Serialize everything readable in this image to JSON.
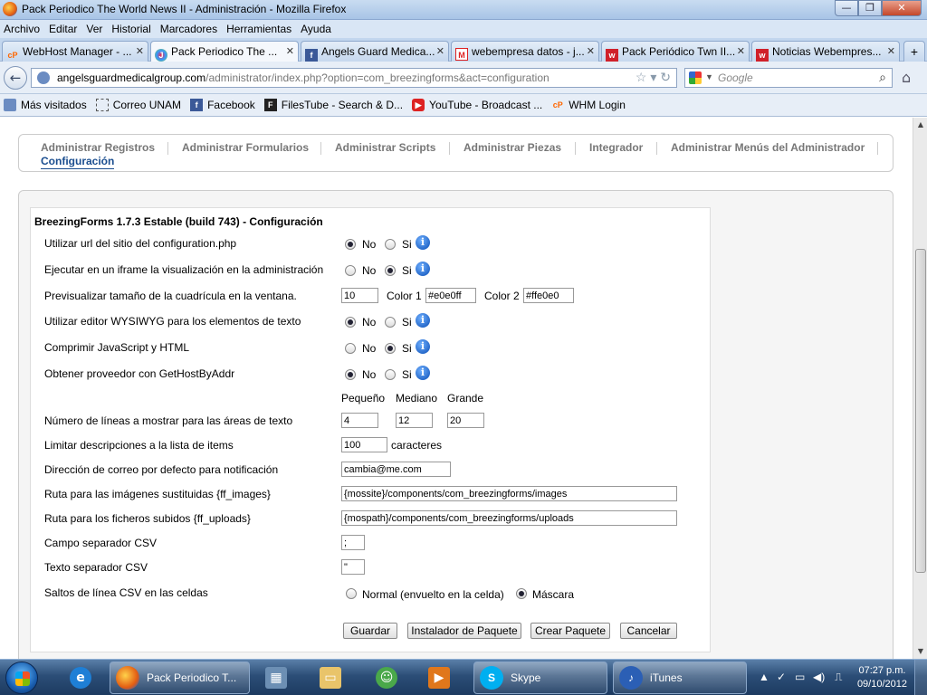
{
  "window": {
    "title": "Pack Periodico The World News II - Administración - Mozilla Firefox",
    "min_label": "—",
    "max_label": "❐",
    "close_label": "✕"
  },
  "menu": [
    "Archivo",
    "Editar",
    "Ver",
    "Historial",
    "Marcadores",
    "Herramientas",
    "Ayuda"
  ],
  "tabs": [
    {
      "label": "WebHost Manager - ...",
      "icon": "cpanel-icon"
    },
    {
      "label": "Pack Periodico The ...",
      "icon": "joomla-icon"
    },
    {
      "label": "Angels Guard Medica...",
      "icon": "facebook-icon"
    },
    {
      "label": "webempresa datos - j...",
      "icon": "gmail-icon"
    },
    {
      "label": "Pack Periódico Twn II...",
      "icon": "webempresa-icon"
    },
    {
      "label": "Noticias Webempres...",
      "icon": "webempresa-icon"
    }
  ],
  "tab_close": "✕",
  "tab_new": "+",
  "nav": {
    "url_host": "angelsguardmedicalgroup.com",
    "url_path": "/administrator/index.php?option=com_breezingforms&act=configuration",
    "search_placeholder": "Google",
    "back_glyph": "←"
  },
  "bookmarks": [
    {
      "label": "Más visitados",
      "icon": "most-visited-icon"
    },
    {
      "label": "Correo UNAM",
      "icon": "page-icon"
    },
    {
      "label": "Facebook",
      "icon": "facebook-icon"
    },
    {
      "label": "FilesTube - Search & D...",
      "icon": "filestube-icon"
    },
    {
      "label": "YouTube - Broadcast ...",
      "icon": "youtube-icon"
    },
    {
      "label": "WHM Login",
      "icon": "cpanel-icon"
    }
  ],
  "submenu": {
    "items": [
      "Administrar Registros",
      "Administrar Formularios",
      "Administrar Scripts",
      "Administrar Piezas",
      "Integrador",
      "Administrar Menús del Administrador"
    ],
    "active": "Configuración"
  },
  "form": {
    "title": "BreezingForms 1.7.3 Estable (build 743) - Configuración",
    "no_label": "No",
    "si_label": "Si",
    "info_glyph": "i",
    "rows": {
      "r1": {
        "label": "Utilizar url del sitio del configuration.php",
        "selected": "No"
      },
      "r2": {
        "label": "Ejecutar en un iframe la visualización en la administración",
        "selected": "Si"
      },
      "r3": {
        "label": "Previsualizar tamaño de la cuadrícula en la ventana.",
        "size": "10",
        "color1_label": "Color 1",
        "color1": "#e0e0ff",
        "color2_label": "Color 2",
        "color2": "#ffe0e0"
      },
      "r4": {
        "label": "Utilizar editor WYSIWYG para los elementos de texto",
        "selected": "No"
      },
      "r5": {
        "label": "Comprimir JavaScript y HTML",
        "selected": "Si"
      },
      "r6": {
        "label": "Obtener proveedor con GetHostByAddr",
        "selected": "No"
      }
    },
    "size_headers": [
      "Pequeño",
      "Mediano",
      "Grande"
    ],
    "lines": {
      "label": "Número de líneas a mostrar para las áreas de texto",
      "small": "4",
      "medium": "12",
      "large": "20"
    },
    "limit": {
      "label": "Limitar descripciones a la lista de items",
      "value": "100",
      "unit": "caracteres"
    },
    "email": {
      "label": "Dirección de correo por defecto para notificación",
      "value": "cambia@me.com"
    },
    "images": {
      "label": "Ruta para las imágenes sustituidas {ff_images}",
      "value": "{mossite}/components/com_breezingforms/images"
    },
    "uploads": {
      "label": "Ruta para los ficheros subidos {ff_uploads}",
      "value": "{mospath}/components/com_breezingforms/uploads"
    },
    "csv_sep": {
      "label": "Campo separador CSV",
      "value": ";"
    },
    "csv_text": {
      "label": "Texto separador CSV",
      "value": "\""
    },
    "csv_lines": {
      "label": "Saltos de línea CSV en las celdas",
      "opt1": "Normal (envuelto en la celda)",
      "opt2": "Máscara",
      "selected": "Máscara"
    },
    "buttons": {
      "save": "Guardar",
      "install": "Instalador de Paquete",
      "create": "Crear Paquete",
      "cancel": "Cancelar"
    }
  },
  "taskbar": {
    "firefox_task": "Pack Periodico T...",
    "skype_task": "Skype",
    "itunes_task": "iTunes",
    "time": "07:27 p.m.",
    "date": "09/10/2012"
  }
}
